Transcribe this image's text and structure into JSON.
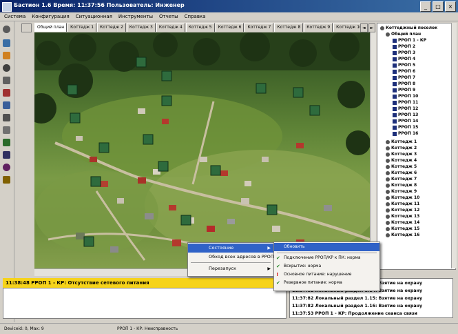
{
  "window": {
    "title": "Бастион 1.6 Время: 11:37:56 Пользователь: Инженер",
    "buttons": [
      "_",
      "□",
      "×"
    ]
  },
  "menu": [
    "Система",
    "Конфигурация",
    "Ситуационная",
    "Инструменты",
    "Отчеты",
    "Справка"
  ],
  "tabs": [
    "Общий план",
    "Коттедж 1",
    "Коттедж 2",
    "Коттедж 3",
    "Коттедж 4",
    "Коттедж 5",
    "Коттедж 6",
    "Коттедж 7",
    "Коттедж 8",
    "Коттедж 9",
    "Коттедж 10"
  ],
  "tab_arrows": [
    "◄",
    "►"
  ],
  "tree": {
    "root": "Коттеджный поселок",
    "plan": "Общий план",
    "rpop": [
      "РРОП 1 - КР",
      "РРОП 2",
      "РРОП 3",
      "РРОП 4",
      "РРОП 5",
      "РРОП 6",
      "РРОП 7",
      "РРОП 8",
      "РРОП 9",
      "РРОП 10",
      "РРОП 11",
      "РРОП 12",
      "РРОП 13",
      "РРОП 14",
      "РРОП 15",
      "РРОП 16"
    ],
    "cottages": [
      "Коттедж 1",
      "Коттедж 2",
      "Коттедж 3",
      "Коттедж 4",
      "Коттедж 5",
      "Коттедж 6",
      "Коттедж 7",
      "Коттедж 8",
      "Коттедж 9",
      "Коттедж 10",
      "Коттедж 11",
      "Коттедж 12",
      "Коттедж 13",
      "Коттедж 14",
      "Коттедж 15",
      "Коттедж 16"
    ]
  },
  "alarm": {
    "text": "11:38:48 РРОП 1 - КР: Отсутствие сетевого питания",
    "color": "#f6d31a"
  },
  "context_menu": {
    "items": [
      "Состояние",
      "Обход всех адресов в РРОП",
      "Перезапуск"
    ]
  },
  "submenu": {
    "items": [
      {
        "icon": "",
        "label": "Обновить"
      },
      {
        "icon": "✔",
        "label": "Подключение РРОП/КР к ПК: норма"
      },
      {
        "icon": "✔",
        "label": "Вскрытие: норма"
      },
      {
        "icon": "!",
        "label": "Основное питание: нарушение"
      },
      {
        "icon": "✔",
        "label": "Резервное питание: норма"
      }
    ]
  },
  "log": [
    "11:37:82 Локальный раздел 1.13: Взятие на охрану",
    "11:37:82 Локальный раздел 1.14: Взятие на охрану",
    "11:37:82 Локальный раздел 1.15: Взятие на охрану",
    "11:37:82 Локальный раздел 1.16: Взятие на охрану",
    "11:37:53 РРОП 1 - КР: Продолжение сеанса связи"
  ],
  "status": {
    "left": "Deviceid: 0, Max: 9",
    "middle": "РРОП 1 - КР: Неисправность"
  },
  "colors": {
    "title_gradient_start": "#0a246a",
    "title_gradient_end": "#3a6ea5",
    "selection": "#3062c7",
    "alarm": "#f6d31a",
    "ok_check": "#2a8a2a",
    "warning": "#d01010"
  }
}
